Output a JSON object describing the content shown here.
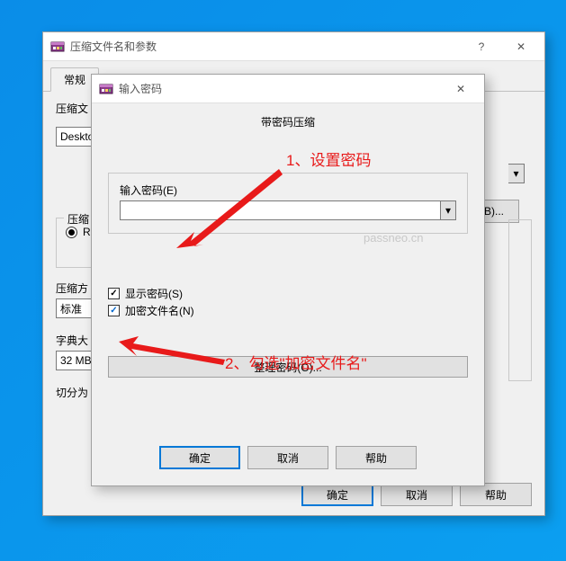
{
  "desktop": {
    "bg": "#0a8de8"
  },
  "parent_dialog": {
    "title": "压缩文件名和参数",
    "help_glyph": "?",
    "close_glyph": "✕",
    "tabs": {
      "general": "常规"
    },
    "labels": {
      "archive_name": "压缩文",
      "archive_name_value": "Deskto",
      "compress_group": "压缩",
      "radio_rar": "R",
      "compress_method": "压缩方",
      "compress_method_value": "标准",
      "dict_size": "字典大",
      "dict_size_value": "32 MB",
      "split": "切分为"
    },
    "browse_btn": "(B)...",
    "buttons": {
      "ok": "确定",
      "cancel": "取消",
      "help": "帮助"
    }
  },
  "child_dialog": {
    "title": "输入密码",
    "close_glyph": "✕",
    "header": "带密码压缩",
    "enter_password_label": "输入密码(E)",
    "show_password_label": "显示密码(S)",
    "encrypt_names_label": "加密文件名(N)",
    "organize_btn": "整理密码(O)...",
    "buttons": {
      "ok": "确定",
      "cancel": "取消",
      "help": "帮助"
    },
    "checkbox_states": {
      "show_password": true,
      "encrypt_names": true
    }
  },
  "annotations": {
    "step1": "1、设置密码",
    "step2": "2、勾选\"加密文件名\"",
    "watermark": "passneo.cn"
  }
}
